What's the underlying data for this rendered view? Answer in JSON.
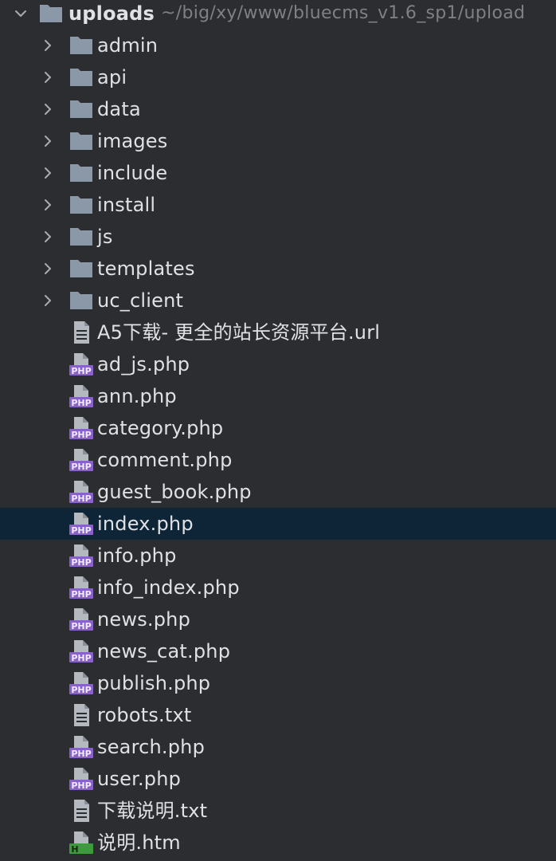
{
  "colors": {
    "background": "#2b2d30",
    "selected_row": "#0e2437",
    "text": "#dfe1e5",
    "path_text": "#7d8085",
    "folder_icon": "#8a98a8",
    "chevron": "#a9abb0",
    "php_badge": "#8a61c9",
    "html_badge": "#3d9a3d",
    "file_icon": "#b4b8bf"
  },
  "root": {
    "name": "uploads",
    "path": "~/big/xy/www/bluecms_v1.6_sp1/upload",
    "expanded": true,
    "icon": "folder-icon"
  },
  "folders": [
    {
      "name": "admin",
      "icon": "folder-icon"
    },
    {
      "name": "api",
      "icon": "folder-icon"
    },
    {
      "name": "data",
      "icon": "folder-icon"
    },
    {
      "name": "images",
      "icon": "folder-icon"
    },
    {
      "name": "include",
      "icon": "folder-icon"
    },
    {
      "name": "install",
      "icon": "folder-icon"
    },
    {
      "name": "js",
      "icon": "folder-icon"
    },
    {
      "name": "templates",
      "icon": "folder-icon"
    },
    {
      "name": "uc_client",
      "icon": "folder-icon"
    }
  ],
  "files": [
    {
      "name": "A5下载- 更全的站长资源平台.url",
      "icon": "text-file-icon"
    },
    {
      "name": "ad_js.php",
      "icon": "php-file-icon"
    },
    {
      "name": "ann.php",
      "icon": "php-file-icon"
    },
    {
      "name": "category.php",
      "icon": "php-file-icon"
    },
    {
      "name": "comment.php",
      "icon": "php-file-icon"
    },
    {
      "name": "guest_book.php",
      "icon": "php-file-icon"
    },
    {
      "name": "index.php",
      "icon": "php-file-icon",
      "selected": true
    },
    {
      "name": "info.php",
      "icon": "php-file-icon"
    },
    {
      "name": "info_index.php",
      "icon": "php-file-icon"
    },
    {
      "name": "news.php",
      "icon": "php-file-icon"
    },
    {
      "name": "news_cat.php",
      "icon": "php-file-icon"
    },
    {
      "name": "publish.php",
      "icon": "php-file-icon"
    },
    {
      "name": "robots.txt",
      "icon": "text-file-icon"
    },
    {
      "name": "search.php",
      "icon": "php-file-icon"
    },
    {
      "name": "user.php",
      "icon": "php-file-icon"
    },
    {
      "name": "下载说明.txt",
      "icon": "text-file-icon"
    },
    {
      "name": "说明.htm",
      "icon": "html-file-icon"
    }
  ],
  "badges": {
    "php": "PHP",
    "html": "H"
  }
}
